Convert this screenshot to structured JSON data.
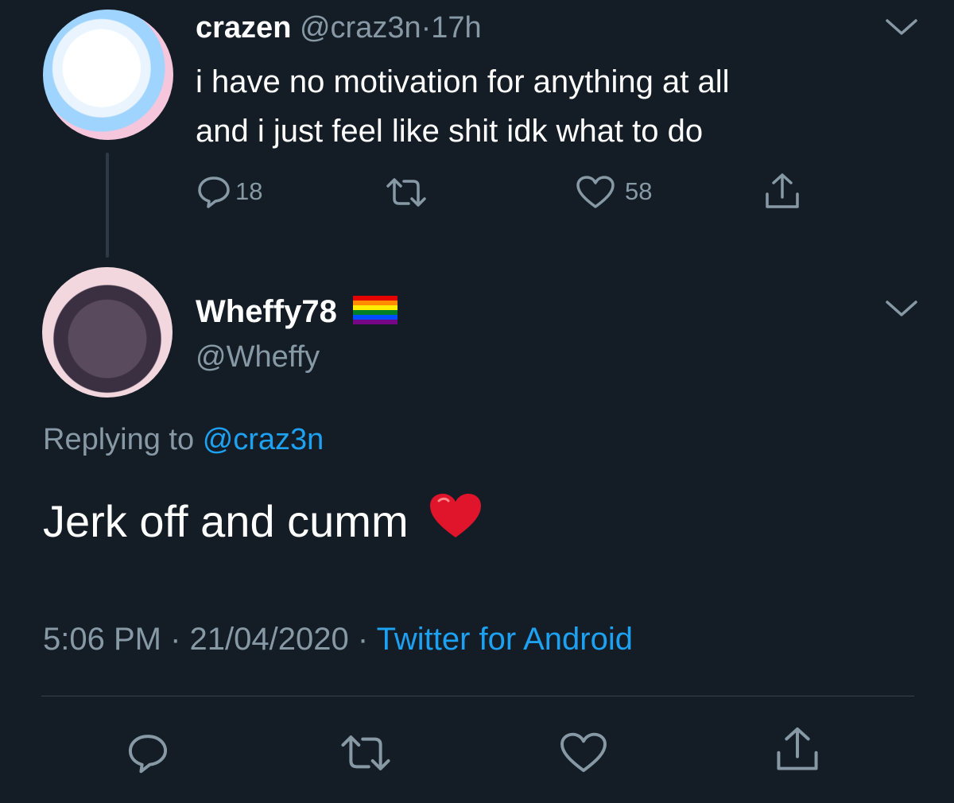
{
  "parent_tweet": {
    "display_name": "crazen",
    "handle": "@craz3n",
    "separator": "·",
    "time": "17h",
    "text_line1": "i have no motivation for anything at all",
    "text_line2": "and i just feel like shit idk what to do",
    "reply_count": "18",
    "like_count": "58"
  },
  "main_tweet": {
    "display_name": "Wheffy78",
    "handle": "@Wheffy",
    "replying_prefix": "Replying to",
    "replying_handle": "@craz3n",
    "text": "Jerk off and cumm",
    "emoji": "❤️",
    "time": "5:06 PM",
    "separator": "·",
    "date": "21/04/2020",
    "source": "Twitter for Android"
  },
  "colors": {
    "background": "#141d26",
    "text": "#ffffff",
    "secondary_text": "#8899a6",
    "link": "#1da1f2",
    "divider": "#38444d"
  },
  "icons": [
    "reply-icon",
    "retweet-icon",
    "like-icon",
    "share-icon",
    "chevron-down-icon",
    "rainbow-flag-icon",
    "heart-emoji"
  ]
}
